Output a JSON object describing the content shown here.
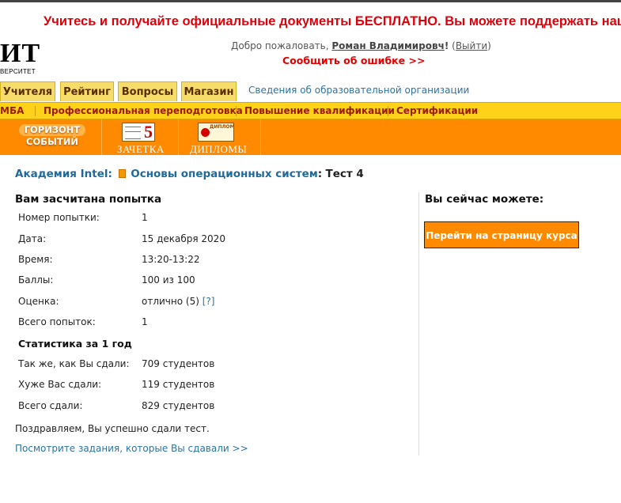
{
  "promo_banner": "Учитесь и получайте официальные документы БЕСПЛАТНО. Вы можете поддержать наш п",
  "logo": {
    "big": "ИТ",
    "small": "ВЕРСИТЕТ"
  },
  "header": {
    "welcome_prefix": "Добро пожаловать,",
    "user_name": "Роман Владимировч",
    "excl": "!",
    "exit_open": "(",
    "exit_label": "Выйти",
    "exit_close": ")",
    "report_error": "Сообщить об ошибке >>"
  },
  "tabs": [
    {
      "label": "Учителя"
    },
    {
      "label": "Рейтинг"
    },
    {
      "label": "Вопросы"
    },
    {
      "label": "Магазин"
    }
  ],
  "org_info_link": "Сведения об образовательной организации",
  "yellow_nav": [
    {
      "label": "МБА"
    },
    {
      "label": "Профессиональная переподготовка"
    },
    {
      "label": "Повышение квалификации"
    },
    {
      "label": "Сертификации"
    }
  ],
  "orange_nav": {
    "horizont_line1": "ГОРИЗОНТ",
    "horizont_line2": "СОБЫТИЙ",
    "zachetka_icon_digit": "5",
    "zachetka_label": "ЗАЧЕТКА",
    "diplomy_icon_text": "ДИПЛОМ",
    "diplomy_label": "ДИПЛОМЫ"
  },
  "breadcrumb": {
    "academy": "Академия Intel",
    "sep1": ":",
    "course": "Основы операционных систем",
    "sep2": ":",
    "current": "Тест 4"
  },
  "attempt": {
    "title": "Вам засчитана попытка",
    "rows": [
      {
        "label": "Номер попытки:",
        "value": "1"
      },
      {
        "label": "Дата:",
        "value": "15 декабря 2020"
      },
      {
        "label": "Время:",
        "value": "13:20-13:22"
      },
      {
        "label": "Баллы:",
        "value": "100 из 100"
      },
      {
        "label": "Оценка:",
        "value": "отлично (5)",
        "hint": "[?]"
      },
      {
        "label": "Всего попыток:",
        "value": "1"
      }
    ]
  },
  "stats": {
    "title": "Статистика за 1 год",
    "rows": [
      {
        "label": "Так же, как Вы сдали:",
        "value": "709 студентов"
      },
      {
        "label": "Хуже Вас сдали:",
        "value": "119 студентов"
      },
      {
        "label": "Всего сдали:",
        "value": "829 студентов"
      }
    ]
  },
  "congrats": "Поздравляем, Вы успешно сдали тест.",
  "view_tasks_link": "Посмотрите задания, которые Вы сдавали >>",
  "right_panel": {
    "title": "Вы сейчас можете:",
    "go_course_button": "Перейти на страницу курса"
  },
  "colors": {
    "promo_red": "#e0000a",
    "orange_bar": "#ff8a00",
    "yellow_bar": "#ffd21a",
    "link_blue": "#1f6a9a"
  }
}
